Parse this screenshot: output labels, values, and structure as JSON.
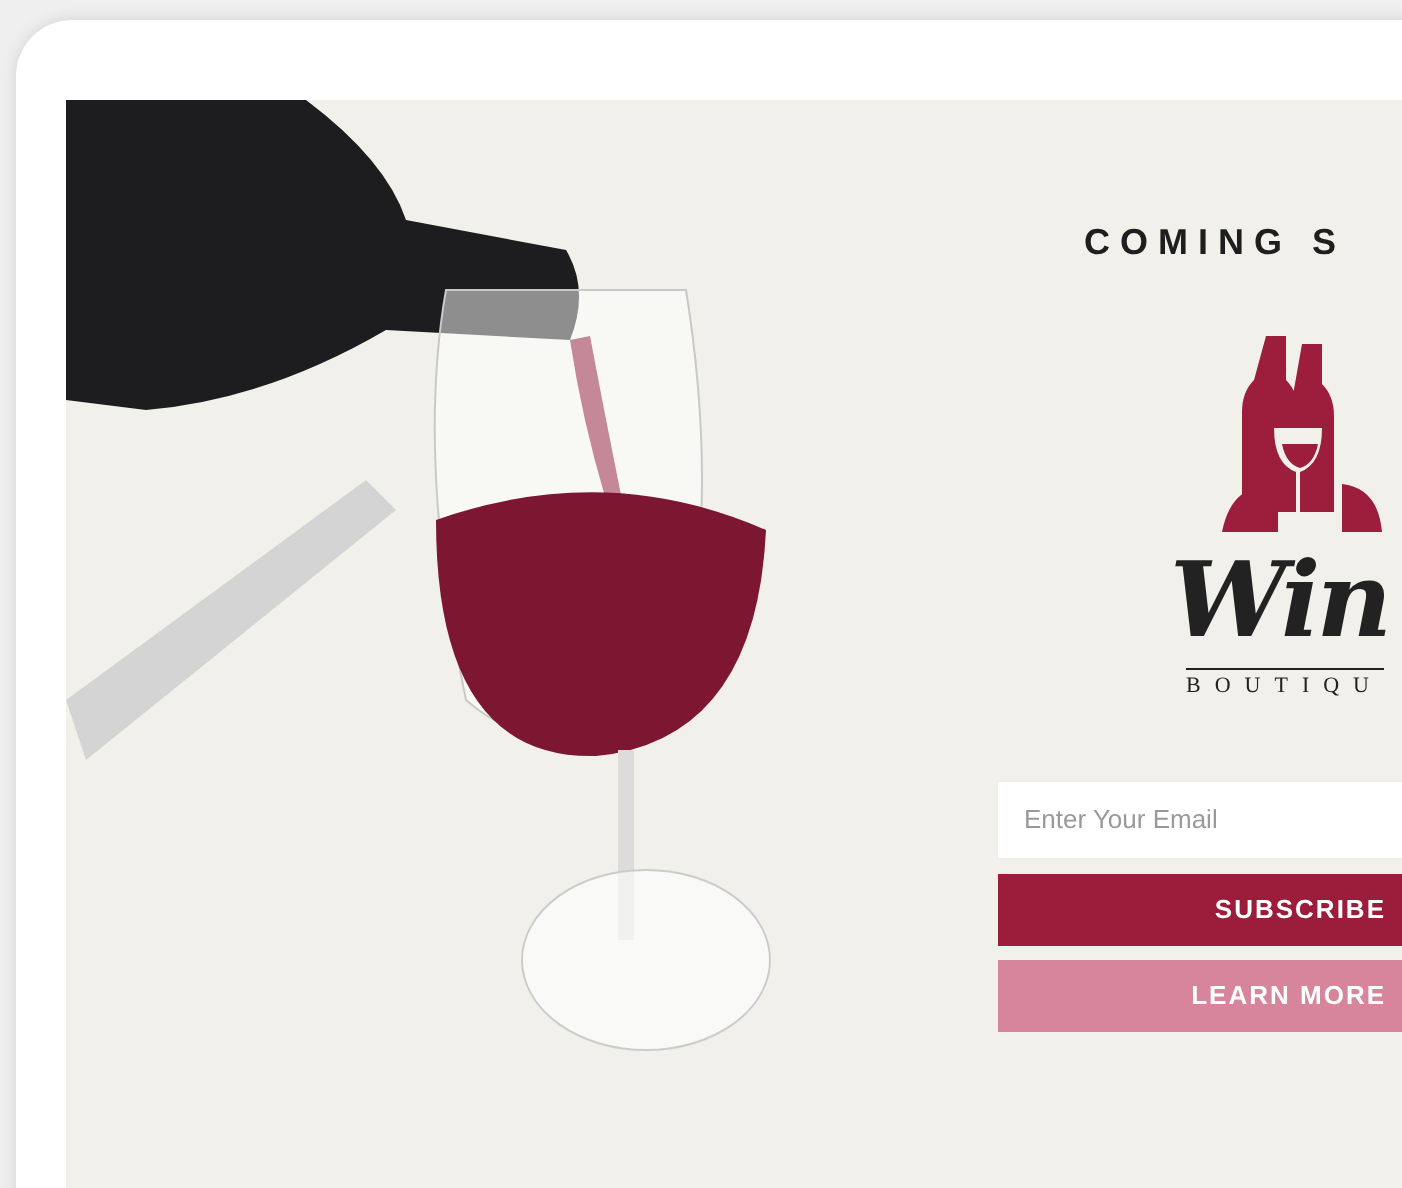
{
  "heading": "COMING S",
  "logo": {
    "script": "Win",
    "subtitle": "BOUTIQU"
  },
  "email": {
    "placeholder": "Enter Your Email"
  },
  "buttons": [
    {
      "label": "SUBSCRIBE",
      "kind": "primary"
    },
    {
      "label": "LEARN MORE",
      "kind": "secondary"
    }
  ]
}
